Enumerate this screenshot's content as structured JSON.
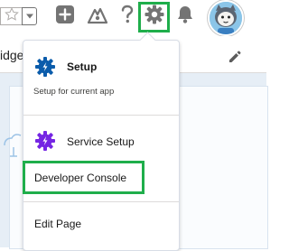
{
  "header": {
    "favorites_icon": "star-icon",
    "favorites_menu_icon": "chevron-down-icon",
    "global_actions_icon": "plus-icon",
    "guidance_icon": "trailhead-icon",
    "help_icon": "question-icon",
    "setup_icon": "gear-icon",
    "notifications_icon": "bell-icon",
    "avatar_icon": "astro-avatar-icon"
  },
  "page": {
    "subbar_text": "idge",
    "edit_icon": "pencil-icon"
  },
  "setup_menu": {
    "items": [
      {
        "label": "Setup",
        "subtitle": "Setup for current app",
        "icon": "setup-gear-icon"
      },
      {
        "label": "Service Setup",
        "icon": "service-setup-gear-icon"
      },
      {
        "label": "Developer Console"
      },
      {
        "label": "Edit Page"
      }
    ]
  },
  "colors": {
    "highlight_green": "#1fae4b",
    "setup_icon_blue": "#0b5cab",
    "service_icon_purple": "#7526e3",
    "header_icon_gray": "#747474"
  }
}
